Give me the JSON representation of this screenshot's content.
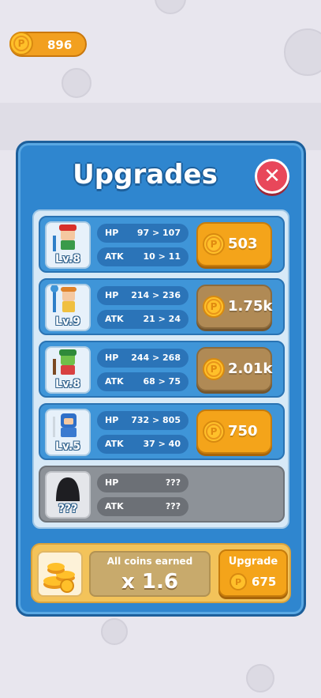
{
  "hud": {
    "coins": "896",
    "coin_icon": "coin-icon"
  },
  "panel": {
    "title": "Upgrades",
    "close_icon": "close-icon"
  },
  "heroes": [
    {
      "level": "Lv.8",
      "hp_label": "HP",
      "hp": "97 > 107",
      "atk_label": "ATK",
      "atk": "10 > 11",
      "price": "503",
      "affordable": true
    },
    {
      "level": "Lv.9",
      "hp_label": "HP",
      "hp": "214 > 236",
      "atk_label": "ATK",
      "atk": "21 > 24",
      "price": "1.75k",
      "affordable": false
    },
    {
      "level": "Lv.8",
      "hp_label": "HP",
      "hp": "244 > 268",
      "atk_label": "ATK",
      "atk": "68 > 75",
      "price": "2.01k",
      "affordable": false
    },
    {
      "level": "Lv.5",
      "hp_label": "HP",
      "hp": "732 > 805",
      "atk_label": "ATK",
      "atk": "37 > 40",
      "price": "750",
      "affordable": true
    },
    {
      "level": "???",
      "hp_label": "HP",
      "hp": "???",
      "atk_label": "ATK",
      "atk": "???",
      "locked": true
    }
  ],
  "coin_bonus": {
    "label": "All coins earned",
    "multiplier": "x 1.6",
    "button_label": "Upgrade",
    "button_price": "675"
  },
  "colors": {
    "panel": "#2f86cf",
    "button": "#f4a41a",
    "close": "#e8475a"
  }
}
